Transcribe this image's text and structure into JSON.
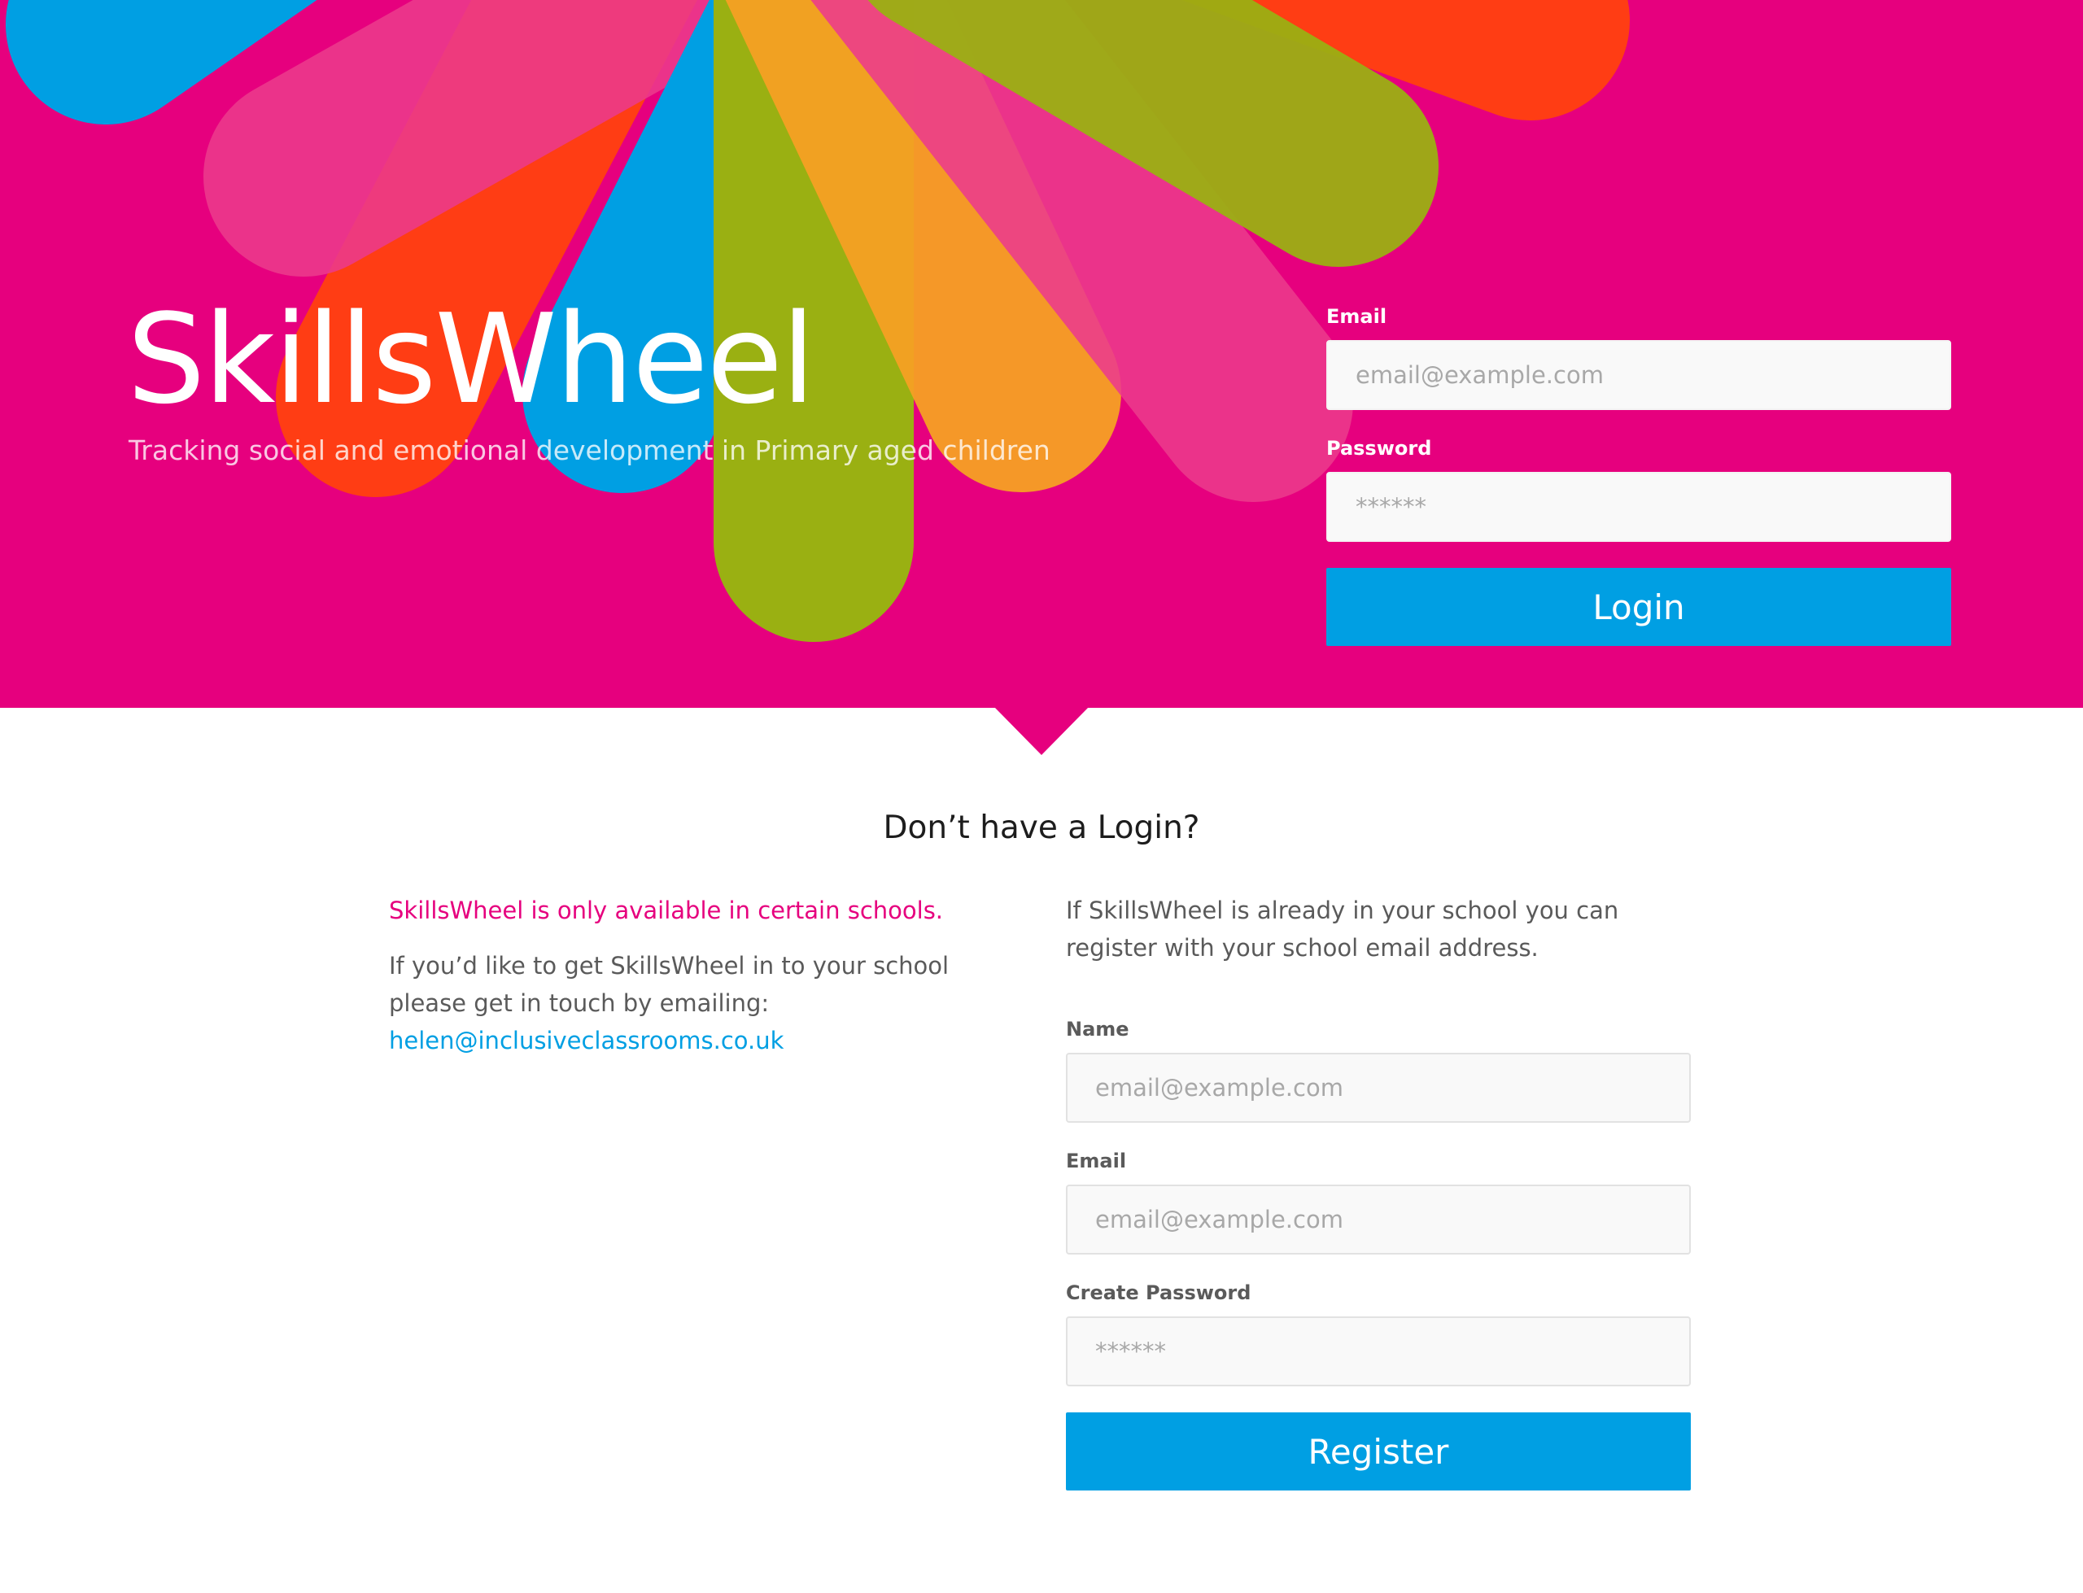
{
  "brand": {
    "title": "SkillsWheel",
    "tagline": "Tracking social and emotional development in Primary aged children"
  },
  "colors": {
    "brand_pink": "#e6007e",
    "accent_blue": "#009fe3",
    "wheel_orange_red": "#ff3d14",
    "wheel_green": "#9ab012",
    "wheel_amber": "#f5a024",
    "wheel_light_pink": "#ec3a8c"
  },
  "login": {
    "email_label": "Email",
    "email_placeholder": "email@example.com",
    "password_label": "Password",
    "password_placeholder": "******",
    "button_label": "Login"
  },
  "register": {
    "heading": "Don’t have a Login?",
    "availability_notice": "SkillsWheel is only available in certain schools.",
    "contact_text": "If you’d like to get SkillsWheel in to your school please get in touch by emailing:",
    "contact_email": "helen@inclusiveclassrooms.co.uk",
    "intro": "If SkillsWheel is already in your school you can register with your school email address.",
    "name_label": "Name",
    "name_placeholder": "email@example.com",
    "email_label": "Email",
    "email_placeholder": "email@example.com",
    "password_label": "Create Password",
    "password_placeholder": "******",
    "button_label": "Register"
  }
}
